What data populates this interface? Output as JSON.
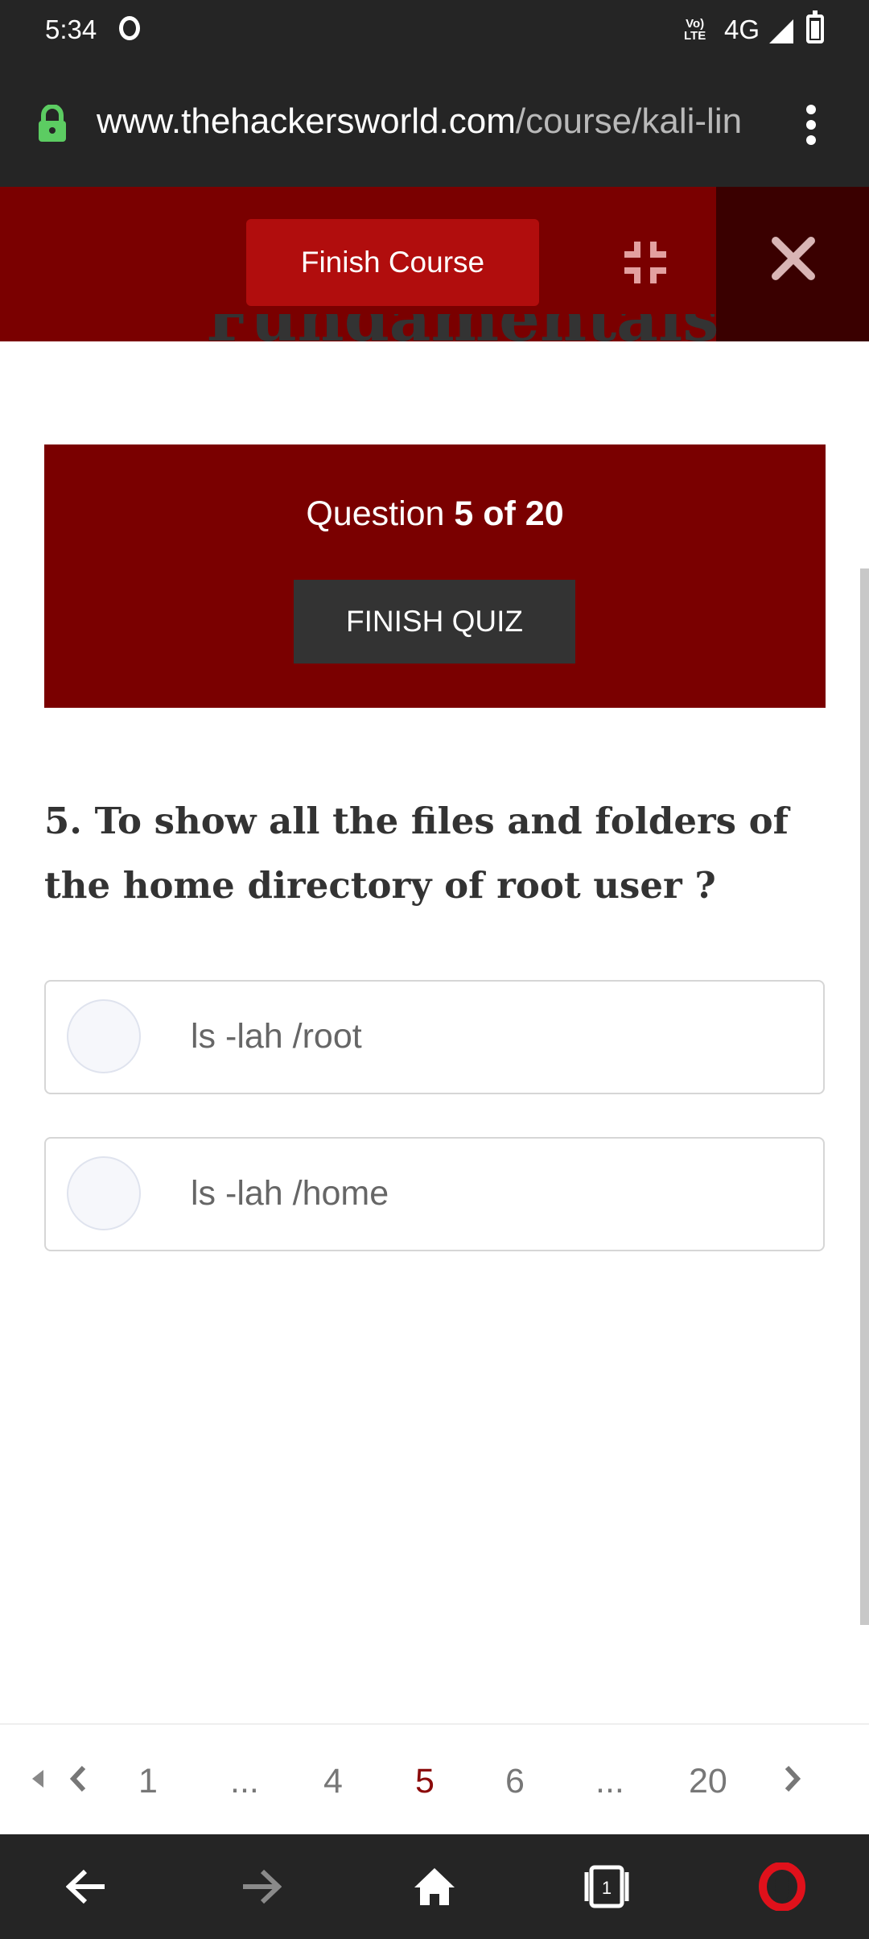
{
  "status_bar": {
    "time": "5:34",
    "network": "4G",
    "volte": "VoLTE"
  },
  "browser": {
    "url_domain": "www.thehackersworld.com",
    "url_path": "/course/kali-lin"
  },
  "course_header": {
    "finish_course_label": "Finish Course",
    "title_fragment": "Fundamentals"
  },
  "quiz": {
    "counter_prefix": "Question",
    "counter_value": "5 of 20",
    "finish_quiz_label": "FINISH QUIZ",
    "question": "5. To show all the files and folders of the home directory of root user ?",
    "options": [
      {
        "label": "ls -lah /root"
      },
      {
        "label": "ls -lah /home"
      }
    ]
  },
  "pagination": {
    "pages": [
      "1",
      "...",
      "4",
      "5",
      "6",
      "...",
      "20"
    ],
    "current": "5"
  },
  "colors": {
    "brand_dark_red": "#7a0000",
    "button_red": "#b10d0d",
    "opera_red": "#e0111b"
  }
}
